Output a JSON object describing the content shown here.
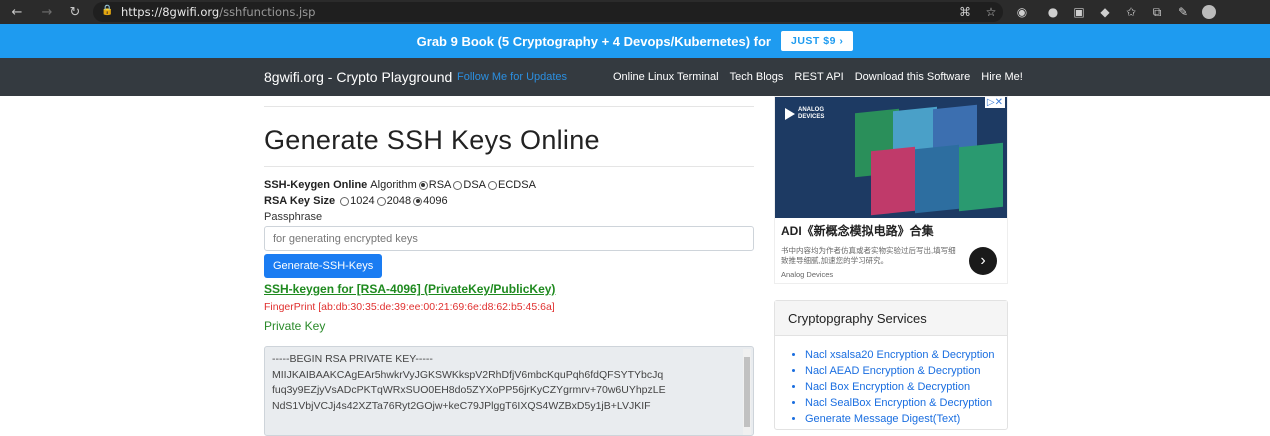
{
  "browser": {
    "url_host": "https://8gwifi.org",
    "url_path": "/sshfunctions.jsp"
  },
  "promo": {
    "text": "Grab 9 Book (5 Cryptography + 4 Devops/Kubernetes) for",
    "button": "JUST $9 ›"
  },
  "navbar": {
    "brand": "8gwifi.org - Crypto Playground",
    "follow": "Follow Me for Updates",
    "links": [
      "Online Linux Terminal",
      "Tech Blogs",
      "REST API",
      "Download this Software",
      "Hire Me!"
    ]
  },
  "main": {
    "title": "Generate SSH Keys Online",
    "keygen_label": "SSH-Keygen Online",
    "algorithm_label": "Algorithm",
    "algorithms": [
      "RSA",
      "DSA",
      "ECDSA"
    ],
    "selected_algorithm": "RSA",
    "keysize_label": "RSA Key Size",
    "key_sizes": [
      "1024",
      "2048",
      "4096"
    ],
    "selected_key_size": "4096",
    "passphrase_label": "Passphrase",
    "passphrase_placeholder": "for generating encrypted keys",
    "generate_button": "Generate-SSH-Keys",
    "result_link": "SSH-keygen for [RSA-4096] (PrivateKey/PublicKey)",
    "fingerprint": "FingerPrint [ab:db:30:35:de:39:ee:00:21:69:6e:d8:62:b5:45:6a]",
    "private_key_label": "Private Key",
    "private_key_lines": [
      "-----BEGIN RSA PRIVATE KEY-----",
      "MIIJKAIBAAKCAgEAr5hwkrVyJGKSWKkspV2RhDfjV6mbcKquPqh6fdQFSYTYbcJq",
      "fuq3y9EZjyVsADcPKTqWRxSUO0EH8do5ZYXoPP56jrKyCZYgrmrv+70w6UYhpzLE",
      "NdS1VbjVCJj4s42XZTa76Ryt2GOjw+keC79JPlggT6IXQS4WZBxD5y1jB+LVJKIF"
    ]
  },
  "ad": {
    "logo_line1": "ANALOG",
    "logo_line2": "DEVICES",
    "title": "ADI《新概念模拟电路》合集",
    "description": "书中内容均为作者仿真或者实物实验过后写出,填写细致推导细腻,加速您的学习研究。",
    "brand": "Analog Devices",
    "arrow": "›"
  },
  "services": {
    "title": "Cryptopgraphy Services",
    "items": [
      "Nacl xsalsa20 Encryption & Decryption",
      "Nacl AEAD Encryption & Decryption",
      "Nacl Box Encryption & Decryption",
      "Nacl SealBox Encryption & Decryption",
      "Generate Message Digest(Text)"
    ]
  },
  "colors": {
    "promo_bg": "#1e9bf0",
    "navbar_bg": "#343a40",
    "primary_button": "#1a7cf2",
    "link_green": "#1f8a1f",
    "fingerprint_red": "#e0302f"
  }
}
